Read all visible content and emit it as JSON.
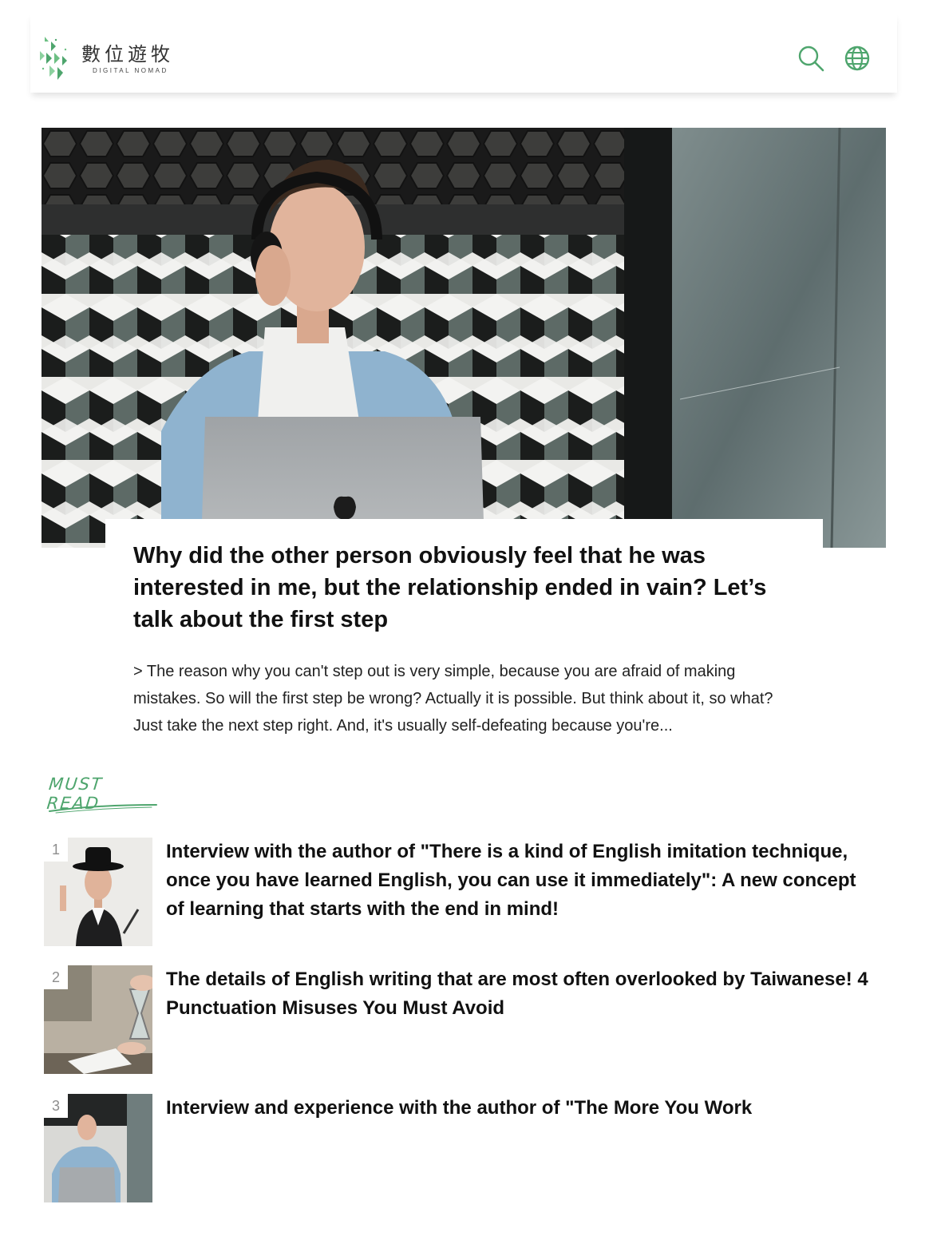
{
  "header": {
    "logo_cn": "數位遊牧",
    "logo_en": "DIGITAL NOMAD",
    "search_icon": "search-icon",
    "globe_icon": "globe-icon",
    "accent": "#4ea56d"
  },
  "hero": {
    "title": "Why did the other person obviously feel that he was interested in me, but the relationship ended in vain? Let’s talk about the first step",
    "excerpt": "> The reason why you can't step out is very simple, because you are afraid of making mistakes. So will the first step be wrong? Actually it is possible. But think about it, so what? Just take the next step right. And, it's usually self-defeating because you're..."
  },
  "must_read": {
    "label": "MUST READ",
    "items": [
      {
        "rank": "1",
        "title": "Interview with the author of \"There is a kind of English imitation technique, once you have learned English, you can use it immediately\": A new concept of learning that starts with the end in mind!"
      },
      {
        "rank": "2",
        "title": "The details of English writing that are most often overlooked by Taiwanese! 4 Punctuation Misuses You Must Avoid"
      },
      {
        "rank": "3",
        "title": "Interview and experience with the author of \"The More You Work"
      }
    ]
  }
}
